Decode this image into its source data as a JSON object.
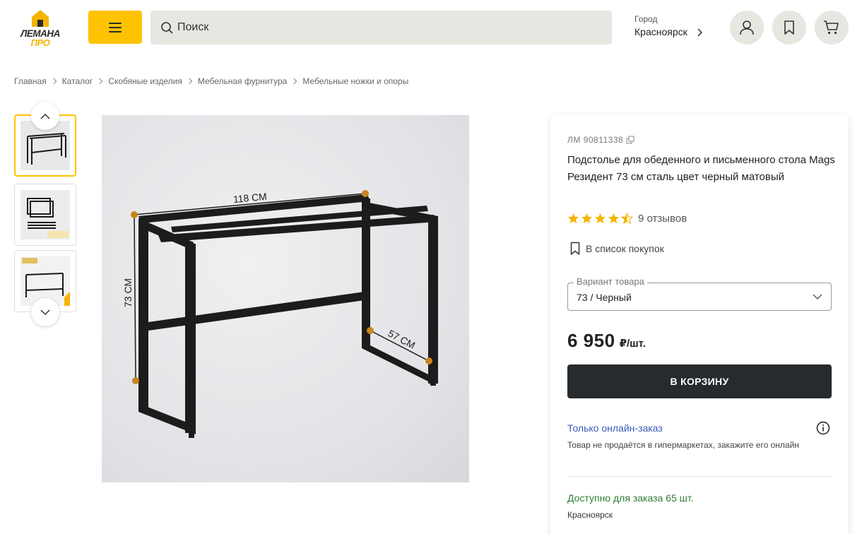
{
  "header": {
    "logo_line1": "ЛЕМАНА",
    "logo_line2": "ПРО",
    "search_placeholder": "Поиск",
    "city_label": "Город",
    "city_name": "Красноярск"
  },
  "breadcrumbs": [
    "Главная",
    "Каталог",
    "Скобяные изделия",
    "Мебельная фурнитура",
    "Мебельные ножки и опоры"
  ],
  "gallery": {
    "thumbnail_count": 3,
    "active_thumbnail": 1,
    "dimensions": {
      "width": "118 СМ",
      "height": "73 СМ",
      "depth": "57 СМ"
    }
  },
  "product": {
    "sku": "ЛМ 90811338",
    "title": "Подстолье для обеденного и письменного стола Mags Резидент 73 см сталь цвет черный матовый",
    "rating": 4.5,
    "reviews": "9 отзывов",
    "shopping_list": "В список покупок",
    "variant_label": "Вариант товара",
    "variant_value": "73 / Черный",
    "price": "6 950",
    "price_unit": "₽/шт.",
    "cart_button": "В КОРЗИНУ",
    "online_title": "Только онлайн-заказ",
    "online_desc": "Товар не продаётся в гипермаркетах, закажите его онлайн",
    "availability": "Доступно для заказа 65 шт.",
    "availability_city": "Красноярск"
  },
  "colors": {
    "brand_yellow": "#fdc300",
    "button_dark": "#272b2e",
    "link_blue": "#3a5bb8",
    "available_green": "#2f7d32",
    "star": "#f5b400"
  }
}
